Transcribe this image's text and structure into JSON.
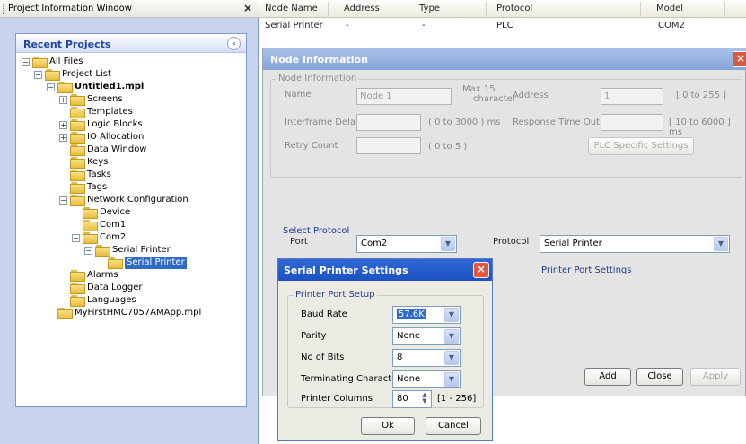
{
  "left_panel": {
    "title": "Project Information Window",
    "close_glyph": "×",
    "recent_projects": {
      "title": "Recent Projects",
      "collapse_glyph": "«"
    },
    "tree": {
      "all_files": "All Files",
      "project_list": "Project List",
      "untitled": "Untitled1.mpl",
      "screens": "Screens",
      "templates": "Templates",
      "logic_blocks": "Logic Blocks",
      "io_allocation": "IO Allocation",
      "data_window": "Data Window",
      "keys": "Keys",
      "tasks": "Tasks",
      "tags": "Tags",
      "network_configuration": "Network Configuration",
      "device": "Device",
      "com1": "Com1",
      "com2": "Com2",
      "serial_printer": "Serial Printer",
      "serial_printer_child": "Serial Printer",
      "alarms": "Alarms",
      "data_logger": "Data Logger",
      "languages": "Languages",
      "other_project": "MyFirstHMC7057AMApp.mpl"
    }
  },
  "node_table": {
    "headers": {
      "node_name": "Node Name",
      "address": "Address",
      "type": "Type",
      "protocol": "Protocol",
      "model": "Model"
    },
    "row": {
      "node_name": "Serial Printer",
      "address": "-",
      "type": "-",
      "protocol": "PLC",
      "model": "COM2"
    }
  },
  "node_dialog": {
    "title": "Node Information",
    "close_glyph": "×",
    "group_label": "Node Information",
    "name_label": "Name",
    "name_value": "Node 1",
    "max_label_1": "Max 15",
    "max_label_2": "character",
    "address_label": "Address",
    "address_value": "1",
    "address_range": "[ 0 to 255 ]",
    "interframe_label": "Interframe Delay",
    "interframe_range": "( 0 to 3000 ) ms",
    "response_label": "Response Time Out",
    "response_range": "[ 10 to 6000 ] ms",
    "retry_label": "Retry Count",
    "retry_range": "( 0 to 5 )",
    "plc_button": "PLC Specific Settings",
    "select_protocol_label": "Select Protocol",
    "port_label": "Port",
    "port_value": "Com2",
    "protocol_label": "Protocol",
    "protocol_value": "Serial Printer",
    "printer_port_link": "Printer Port Settings",
    "add_button": "Add",
    "close_button": "Close",
    "apply_button": "Apply"
  },
  "sp_dialog": {
    "title": "Serial Printer Settings",
    "close_glyph": "×",
    "group_label": "Printer Port Setup",
    "baud_label": "Baud Rate",
    "baud_value": "57.6K",
    "parity_label": "Parity",
    "parity_value": "None",
    "bits_label": "No of Bits",
    "bits_value": "8",
    "term_label": "Terminating Character",
    "term_value": "None",
    "columns_label": "Printer Columns",
    "columns_value": "80",
    "columns_range": "[1 - 256]",
    "ok_button": "Ok",
    "cancel_button": "Cancel"
  }
}
